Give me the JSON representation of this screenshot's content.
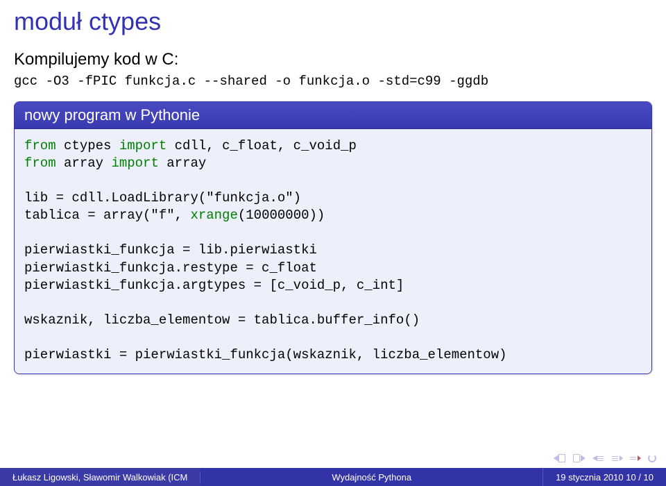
{
  "title": "moduł ctypes",
  "subheading": "Kompilujemy kod w C:",
  "gcc_cmd": "gcc -O3 -fPIC funkcja.c --shared -o funkcja.o -std=c99 -ggdb",
  "block": {
    "header": "nowy program w Pythonie",
    "code": {
      "l1_kw1": "from",
      "l1_mod": " ctypes ",
      "l1_kw2": "import",
      "l1_rest": " cdll, c_float, c_void_p",
      "l2_kw1": "from",
      "l2_mod": " array ",
      "l2_kw2": "import",
      "l2_rest": " array",
      "l3": "lib = cdll.LoadLibrary(\"funkcja.o\")",
      "l4a": "tablica = array(\"f\", ",
      "l4b": "xrange",
      "l4c": "(10000000))",
      "l5": "pierwiastki_funkcja = lib.pierwiastki",
      "l6": "pierwiastki_funkcja.restype = c_float",
      "l7": "pierwiastki_funkcja.argtypes = [c_void_p, c_int]",
      "l8": "wskaznik, liczba_elementow = tablica.buffer_info()",
      "l9": "pierwiastki = pierwiastki_funkcja(wskaznik, liczba_elementow)"
    }
  },
  "footer": {
    "left": "Łukasz Ligowski, Sławomir Walkowiak (ICM",
    "center": "Wydajność Pythona",
    "right": "19 stycznia 2010     10 / 10"
  }
}
